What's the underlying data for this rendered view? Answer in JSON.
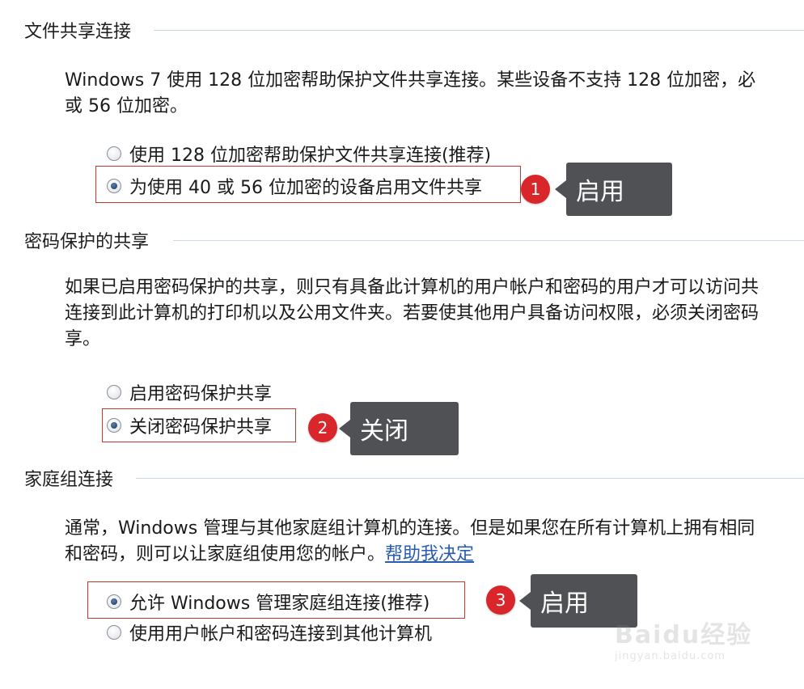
{
  "sections": {
    "file_sharing": {
      "title": "文件共享连接",
      "desc_line1": "Windows 7 使用 128 位加密帮助保护文件共享连接。某些设备不支持 128 位加密，必",
      "desc_line2": "或 56 位加密。",
      "options": [
        {
          "label": "使用 128 位加密帮助保护文件共享连接(推荐)",
          "selected": false
        },
        {
          "label": "为使用 40 或 56 位加密的设备启用文件共享",
          "selected": true
        }
      ]
    },
    "password_sharing": {
      "title": "密码保护的共享",
      "desc_line1": "如果已启用密码保护的共享，则只有具备此计算机的用户帐户和密码的用户才可以访问共",
      "desc_line2": "连接到此计算机的打印机以及公用文件夹。若要使其他用户具备访问权限，必须关闭密码",
      "desc_line3": "享。",
      "options": [
        {
          "label": "启用密码保护共享",
          "selected": false
        },
        {
          "label": "关闭密码保护共享",
          "selected": true
        }
      ]
    },
    "homegroup": {
      "title": "家庭组连接",
      "desc_line1": "通常，Windows 管理与其他家庭组计算机的连接。但是如果您在所有计算机上拥有相同",
      "desc_line2": "和密码，则可以让家庭组使用您的帐户。",
      "help_link": "帮助我决定",
      "options": [
        {
          "label": "允许 Windows 管理家庭组连接(推荐)",
          "selected": true
        },
        {
          "label": "使用用户帐户和密码连接到其他计算机",
          "selected": false
        }
      ]
    }
  },
  "annotations": [
    {
      "number": "1",
      "text": "启用"
    },
    {
      "number": "2",
      "text": "关闭"
    },
    {
      "number": "3",
      "text": "启用"
    }
  ],
  "watermark": {
    "main": "Baidu经验",
    "sub": "jingyan.baidu.com"
  },
  "colors": {
    "annotation_red": "#d9262a",
    "callout_bg": "#4f5154",
    "link": "#2a5db0",
    "rule": "#c9d6e3"
  }
}
